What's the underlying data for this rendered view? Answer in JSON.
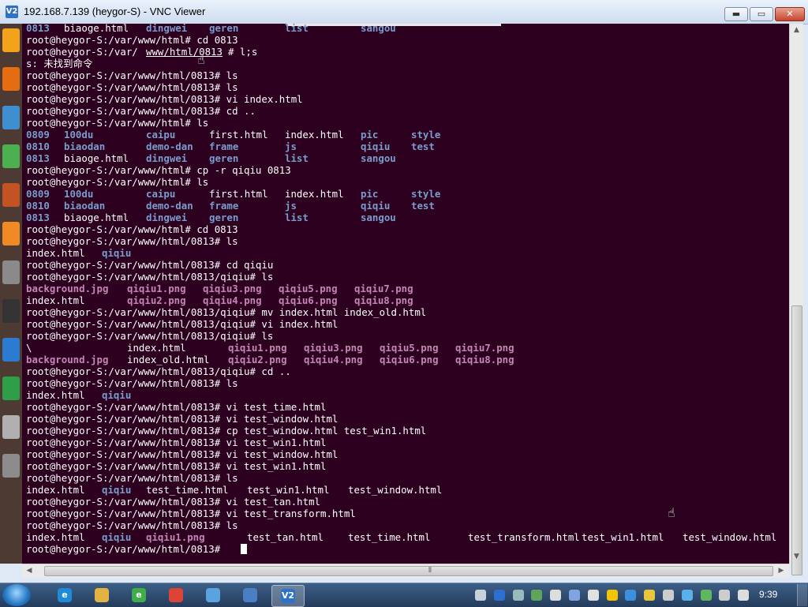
{
  "window": {
    "title": "192.168.7.139 (heygor-S) - VNC Viewer",
    "app_icon": "V2",
    "minimize": "▬",
    "maximize": "▭",
    "close": "✕"
  },
  "terminal": {
    "bg_color": "#2c001e",
    "dir_color": "#7b9ccc",
    "image_color": "#c685b8",
    "lines": [
      {
        "seg": [
          [
            "0813",
            "d"
          ],
          [
            "biaoge.html",
            ""
          ],
          [
            "dingwei",
            "d"
          ],
          [
            "geren",
            "d"
          ],
          [
            "list",
            "d"
          ],
          [
            "sangou",
            "d"
          ]
        ]
      },
      {
        "seg": [
          [
            "root@heygor-S:/var/www/html# cd 0813",
            ""
          ]
        ]
      },
      {
        "seg": [
          [
            "root@heygor-S:/var/",
            ""
          ],
          [
            "www/html/0813",
            "u"
          ],
          [
            "# l;s",
            ""
          ]
        ]
      },
      {
        "seg": [
          [
            "s: 未找到命令",
            ""
          ]
        ]
      },
      {
        "seg": [
          [
            "root@heygor-S:/var/www/html/0813# ls",
            ""
          ]
        ]
      },
      {
        "seg": [
          [
            "root@heygor-S:/var/www/html/0813# ls",
            ""
          ]
        ]
      },
      {
        "seg": [
          [
            "root@heygor-S:/var/www/html/0813# vi index.html",
            ""
          ]
        ]
      },
      {
        "seg": [
          [
            "root@heygor-S:/var/www/html/0813# cd ..",
            ""
          ]
        ]
      },
      {
        "seg": [
          [
            "root@heygor-S:/var/www/html# ls",
            ""
          ]
        ]
      },
      {
        "seg": [
          [
            "0809",
            "d"
          ],
          [
            "100du",
            "d"
          ],
          [
            "caipu",
            "d"
          ],
          [
            "first.html",
            ""
          ],
          [
            "index.html",
            ""
          ],
          [
            "pic",
            "d"
          ],
          [
            "style",
            "d"
          ]
        ]
      },
      {
        "seg": [
          [
            "0810",
            "d"
          ],
          [
            "biaodan",
            "d"
          ],
          [
            "demo-dan",
            "d"
          ],
          [
            "frame",
            "d"
          ],
          [
            "js",
            "d"
          ],
          [
            "qiqiu",
            "d"
          ],
          [
            "test",
            "d"
          ]
        ]
      },
      {
        "seg": [
          [
            "0813",
            "d"
          ],
          [
            "biaoge.html",
            ""
          ],
          [
            "dingwei",
            "d"
          ],
          [
            "geren",
            "d"
          ],
          [
            "list",
            "d"
          ],
          [
            "sangou",
            "d"
          ]
        ]
      },
      {
        "seg": [
          [
            "root@heygor-S:/var/www/html# cp -r qiqiu 0813",
            ""
          ]
        ]
      },
      {
        "seg": [
          [
            "root@heygor-S:/var/www/html# ls",
            ""
          ]
        ]
      },
      {
        "seg": [
          [
            "0809",
            "d"
          ],
          [
            "100du",
            "d"
          ],
          [
            "caipu",
            "d"
          ],
          [
            "first.html",
            ""
          ],
          [
            "index.html",
            ""
          ],
          [
            "pic",
            "d"
          ],
          [
            "style",
            "d"
          ]
        ]
      },
      {
        "seg": [
          [
            "0810",
            "d"
          ],
          [
            "biaodan",
            "d"
          ],
          [
            "demo-dan",
            "d"
          ],
          [
            "frame",
            "d"
          ],
          [
            "js",
            "d"
          ],
          [
            "qiqiu",
            "d"
          ],
          [
            "test",
            "d"
          ]
        ]
      },
      {
        "seg": [
          [
            "0813",
            "d"
          ],
          [
            "biaoge.html",
            ""
          ],
          [
            "dingwei",
            "d"
          ],
          [
            "geren",
            "d"
          ],
          [
            "list",
            "d"
          ],
          [
            "sangou",
            "d"
          ]
        ]
      },
      {
        "seg": [
          [
            "root@heygor-S:/var/www/html# cd 0813",
            ""
          ]
        ]
      },
      {
        "seg": [
          [
            "root@heygor-S:/var/www/html/0813# ls",
            ""
          ]
        ]
      },
      {
        "seg": [
          [
            "index.html",
            ""
          ],
          [
            "qiqiu",
            "d"
          ]
        ]
      },
      {
        "seg": [
          [
            "root@heygor-S:/var/www/html/0813# cd qiqiu",
            ""
          ]
        ]
      },
      {
        "seg": [
          [
            "root@heygor-S:/var/www/html/0813/qiqiu# ls",
            ""
          ]
        ]
      },
      {
        "seg": [
          [
            "background.jpg",
            "p"
          ],
          [
            "qiqiu1.png",
            "p"
          ],
          [
            "qiqiu3.png",
            "p"
          ],
          [
            "qiqiu5.png",
            "p"
          ],
          [
            "qiqiu7.png",
            "p"
          ]
        ]
      },
      {
        "seg": [
          [
            "index.html",
            ""
          ],
          [
            "qiqiu2.png",
            "p"
          ],
          [
            "qiqiu4.png",
            "p"
          ],
          [
            "qiqiu6.png",
            "p"
          ],
          [
            "qiqiu8.png",
            "p"
          ]
        ]
      },
      {
        "seg": [
          [
            "root@heygor-S:/var/www/html/0813/qiqiu# mv index.html index_old.html",
            ""
          ]
        ]
      },
      {
        "seg": [
          [
            "root@heygor-S:/var/www/html/0813/qiqiu# vi index.html",
            ""
          ]
        ]
      },
      {
        "seg": [
          [
            "root@heygor-S:/var/www/html/0813/qiqiu# ls",
            ""
          ]
        ]
      },
      {
        "seg": [
          [
            "\\",
            ""
          ],
          [
            "index.html",
            ""
          ],
          [
            "qiqiu1.png",
            "p"
          ],
          [
            "qiqiu3.png",
            "p"
          ],
          [
            "qiqiu5.png",
            "p"
          ],
          [
            "qiqiu7.png",
            "p"
          ]
        ]
      },
      {
        "seg": [
          [
            "background.jpg",
            "p"
          ],
          [
            "index_old.html",
            ""
          ],
          [
            "qiqiu2.png",
            "p"
          ],
          [
            "qiqiu4.png",
            "p"
          ],
          [
            "qiqiu6.png",
            "p"
          ],
          [
            "qiqiu8.png",
            "p"
          ]
        ]
      },
      {
        "seg": [
          [
            "root@heygor-S:/var/www/html/0813/qiqiu# cd ..",
            ""
          ]
        ]
      },
      {
        "seg": [
          [
            "root@heygor-S:/var/www/html/0813# ls",
            ""
          ]
        ]
      },
      {
        "seg": [
          [
            "index.html",
            ""
          ],
          [
            "qiqiu",
            "d"
          ]
        ]
      },
      {
        "seg": [
          [
            "root@heygor-S:/var/www/html/0813# vi test_time.html",
            ""
          ]
        ]
      },
      {
        "seg": [
          [
            "root@heygor-S:/var/www/html/0813# vi test_window.html",
            ""
          ]
        ]
      },
      {
        "seg": [
          [
            "root@heygor-S:/var/www/html/0813# cp test_window.html test_win1.html",
            ""
          ]
        ]
      },
      {
        "seg": [
          [
            "root@heygor-S:/var/www/html/0813# vi test_win1.html",
            ""
          ]
        ]
      },
      {
        "seg": [
          [
            "root@heygor-S:/var/www/html/0813# vi test_window.html",
            ""
          ]
        ]
      },
      {
        "seg": [
          [
            "root@heygor-S:/var/www/html/0813# vi test_win1.html",
            ""
          ]
        ]
      },
      {
        "seg": [
          [
            "root@heygor-S:/var/www/html/0813# ls",
            ""
          ]
        ]
      },
      {
        "seg": [
          [
            "index.html",
            ""
          ],
          [
            "qiqiu",
            "d"
          ],
          [
            "test_time.html",
            ""
          ],
          [
            "test_win1.html",
            ""
          ],
          [
            "test_window.html",
            ""
          ]
        ]
      },
      {
        "seg": [
          [
            "root@heygor-S:/var/www/html/0813# vi test_tan.html",
            ""
          ]
        ]
      },
      {
        "seg": [
          [
            "root@heygor-S:/var/www/html/0813# vi test_transform.html",
            ""
          ]
        ]
      },
      {
        "seg": [
          [
            "root@heygor-S:/var/www/html/0813# ls",
            ""
          ]
        ]
      },
      {
        "seg": [
          [
            "index.html",
            ""
          ],
          [
            "qiqiu",
            "d"
          ],
          [
            "qiqiu1.png",
            "p"
          ],
          [
            "test_tan.html",
            ""
          ],
          [
            "test_time.html",
            ""
          ],
          [
            "test_transform.html",
            ""
          ],
          [
            "test_win1.html",
            ""
          ],
          [
            "test_window.html",
            ""
          ]
        ]
      },
      {
        "seg": [
          [
            "root@heygor-S:/var/www/html/0813# ",
            ""
          ]
        ],
        "cursor": true
      }
    ]
  },
  "scrollbar": {
    "up": "▲",
    "down": "▼",
    "left": "◀",
    "right": "▶",
    "grip": "⦀"
  },
  "launcher_icons": [
    "files-icon",
    "firefox-icon",
    "writer-icon",
    "calc-icon",
    "impress-icon",
    "software-center-icon",
    "settings-icon",
    "terminal-icon",
    "remote-icon",
    "update-icon",
    "tools-icon",
    "trash-icon"
  ],
  "taskbar": {
    "buttons": [
      "ie-icon",
      "explorer-icon",
      "browser360-icon",
      "chrome-icon",
      "qq-browser-icon",
      "media-icon",
      "vnc-viewer-icon"
    ],
    "tray": [
      "keyboard-icon",
      "help-icon",
      "network-icon",
      "antivirus-icon",
      "notify-icon",
      "tray-app-icon",
      "flag-icon",
      "qq-icon",
      "chat-icon",
      "shield-icon",
      "volume-icon",
      "ime-icon",
      "security-icon",
      "display-icon",
      "monitor-icon"
    ],
    "clock": "9:39"
  }
}
